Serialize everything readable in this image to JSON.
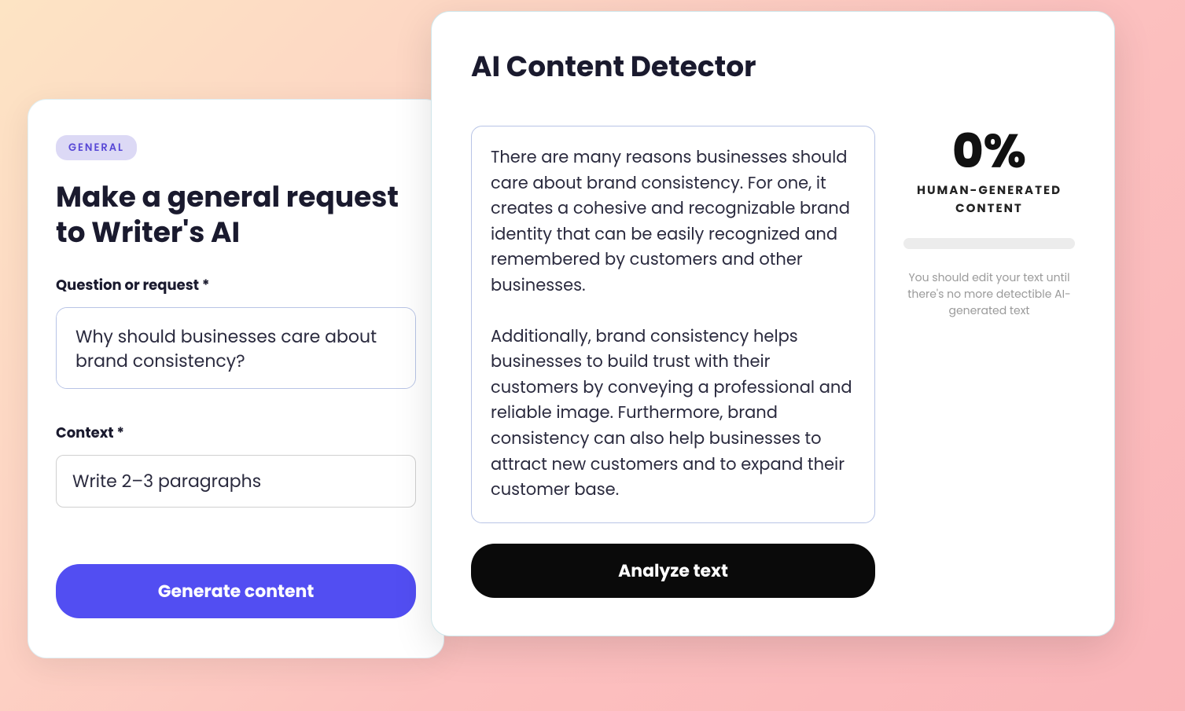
{
  "left": {
    "badge": "GENERAL",
    "title": "Make a general request to Writer's AI",
    "question_label": "Question or request *",
    "question_value": "Why should businesses care about brand consistency?",
    "context_label": "Context *",
    "context_value": "Write 2–3 paragraphs",
    "generate_button": "Generate content"
  },
  "right": {
    "title": "AI Content Detector",
    "content_text": "There are many reasons businesses should care about brand consistency. For one, it creates a cohesive and recognizable brand identity that can be easily recognized and remembered by customers and other businesses.\n\nAdditionally, brand consistency helps businesses to build trust with their customers by conveying a professional and reliable image. Furthermore, brand consistency can also help businesses to attract new customers and to expand their customer base.",
    "analyze_button": "Analyze text",
    "score_value": "0%",
    "score_label": "HUMAN-GENERATED CONTENT",
    "hint": "You should edit your text until there's no more detectible AI-generated text"
  }
}
